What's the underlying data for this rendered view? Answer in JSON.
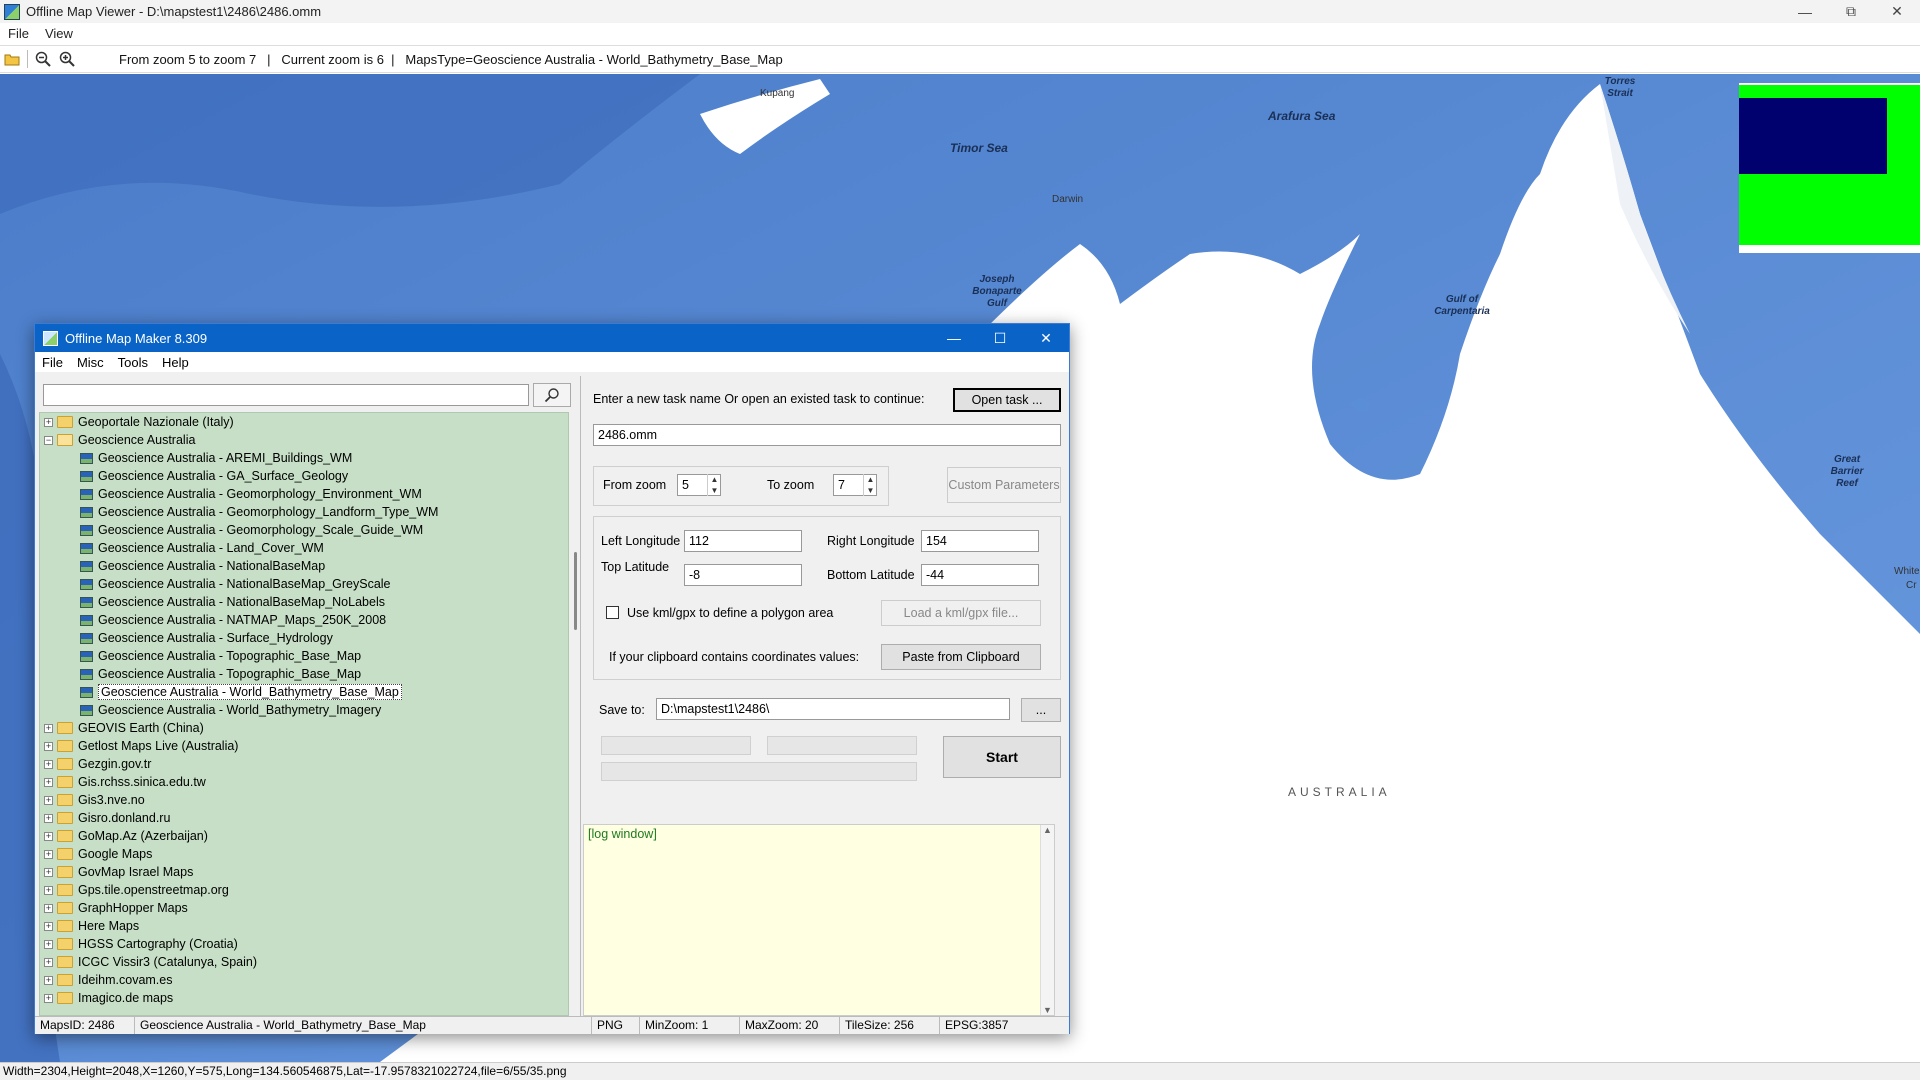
{
  "viewer": {
    "title": "Offline Map Viewer - D:\\mapstest1\\2486\\2486.omm",
    "menu": [
      "File",
      "View"
    ],
    "toolbar": {
      "zoom_range": "From zoom 5 to zoom 7",
      "current_zoom": "Current zoom is 6",
      "maps_type": "MapsType=Geoscience Australia - World_Bathymetry_Base_Map"
    },
    "status": "Width=2304,Height=2048,X=1260,Y=575,Long=134.560546875,Lat=-17.9578321022724,file=6/55/35.png"
  },
  "map": {
    "labels": {
      "kupang": "Kupang",
      "timor_sea": "Timor Sea",
      "arafura_sea": "Arafura Sea",
      "darwin": "Darwin",
      "joseph_bonaparte": "Joseph Bonaparte Gulf",
      "gulf_carpentaria": "Gulf of Carpentaria",
      "great_barrier_reef": "Great Barrier Reef",
      "torres_strait": "Torres Strait",
      "australia": "AUSTRALIA",
      "white": "White",
      "cr": "Cr"
    },
    "colors": {
      "ocean": "#5a8fd8",
      "deep_ocean": "#3f6fbf",
      "land": "#ffffff",
      "legend_green": "#00ff00",
      "legend_navy": "#00006e"
    }
  },
  "dialog": {
    "title": "Offline Map Maker 8.309",
    "menu": [
      "File",
      "Misc",
      "Tools",
      "Help"
    ],
    "search": {
      "value": "",
      "placeholder": ""
    },
    "tree": [
      {
        "label": "Geoportale Nazionale (Italy)",
        "level": 0,
        "expanded": false
      },
      {
        "label": "Geoscience Australia",
        "level": 0,
        "expanded": true
      },
      {
        "label": "Geoscience Australia - AREMI_Buildings_WM",
        "level": 1
      },
      {
        "label": "Geoscience Australia - GA_Surface_Geology",
        "level": 1
      },
      {
        "label": "Geoscience Australia - Geomorphology_Environment_WM",
        "level": 1
      },
      {
        "label": "Geoscience Australia - Geomorphology_Landform_Type_WM",
        "level": 1
      },
      {
        "label": "Geoscience Australia - Geomorphology_Scale_Guide_WM",
        "level": 1
      },
      {
        "label": "Geoscience Australia - Land_Cover_WM",
        "level": 1
      },
      {
        "label": "Geoscience Australia - NationalBaseMap",
        "level": 1
      },
      {
        "label": "Geoscience Australia - NationalBaseMap_GreyScale",
        "level": 1
      },
      {
        "label": "Geoscience Australia - NationalBaseMap_NoLabels",
        "level": 1
      },
      {
        "label": "Geoscience Australia - NATMAP_Maps_250K_2008",
        "level": 1
      },
      {
        "label": "Geoscience Australia - Surface_Hydrology",
        "level": 1
      },
      {
        "label": "Geoscience Australia - Topographic_Base_Map",
        "level": 1
      },
      {
        "label": "Geoscience Australia - Topographic_Base_Map",
        "level": 1
      },
      {
        "label": "Geoscience Australia - World_Bathymetry_Base_Map",
        "level": 1,
        "selected": true
      },
      {
        "label": "Geoscience Australia - World_Bathymetry_Imagery",
        "level": 1
      },
      {
        "label": "GEOVIS Earth (China)",
        "level": 0,
        "expanded": false
      },
      {
        "label": "Getlost Maps Live (Australia)",
        "level": 0,
        "expanded": false
      },
      {
        "label": "Gezgin.gov.tr",
        "level": 0,
        "expanded": false
      },
      {
        "label": "Gis.rchss.sinica.edu.tw",
        "level": 0,
        "expanded": false
      },
      {
        "label": "Gis3.nve.no",
        "level": 0,
        "expanded": false
      },
      {
        "label": "Gisro.donland.ru",
        "level": 0,
        "expanded": false
      },
      {
        "label": "GoMap.Az (Azerbaijan)",
        "level": 0,
        "expanded": false
      },
      {
        "label": "Google Maps",
        "level": 0,
        "expanded": false
      },
      {
        "label": "GovMap Israel Maps",
        "level": 0,
        "expanded": false
      },
      {
        "label": "Gps.tile.openstreetmap.org",
        "level": 0,
        "expanded": false
      },
      {
        "label": "GraphHopper Maps",
        "level": 0,
        "expanded": false
      },
      {
        "label": "Here Maps",
        "level": 0,
        "expanded": false
      },
      {
        "label": "HGSS Cartography (Croatia)",
        "level": 0,
        "expanded": false
      },
      {
        "label": "ICGC Vissir3 (Catalunya, Spain)",
        "level": 0,
        "expanded": false
      },
      {
        "label": "Ideihm.covam.es",
        "level": 0,
        "expanded": false
      },
      {
        "label": "Imagico.de maps",
        "level": 0,
        "expanded": false
      }
    ],
    "form": {
      "task_prompt": "Enter a new task name Or open an existed task to continue:",
      "open_task_label": "Open task ...",
      "task_name": "2486.omm",
      "from_zoom_label": "From zoom",
      "from_zoom": "5",
      "to_zoom_label": "To zoom",
      "to_zoom": "7",
      "custom_params_label": "Custom Parameters",
      "left_lon_label": "Left Longitude",
      "left_lon": "112",
      "right_lon_label": "Right Longitude",
      "right_lon": "154",
      "top_lat_label": "Top Latitude",
      "top_lat": "-8",
      "bottom_lat_label": "Bottom Latitude",
      "bottom_lat": "-44",
      "kml_label": "Use kml/gpx to define a polygon area",
      "kml_checked": false,
      "load_kml_label": "Load a kml/gpx file...",
      "clipboard_prompt": "If your clipboard contains coordinates values:",
      "paste_label": "Paste from Clipboard",
      "save_to_label": "Save to:",
      "save_to": "D:\\mapstest1\\2486\\",
      "browse_label": "...",
      "start_label": "Start"
    },
    "log": "[log window]",
    "status": {
      "maps_id": "MapsID: 2486",
      "maps_name": "Geoscience Australia - World_Bathymetry_Base_Map",
      "format": "PNG",
      "min_zoom": "MinZoom: 1",
      "max_zoom": "MaxZoom: 20",
      "tile_size": "TileSize: 256",
      "epsg": "EPSG:3857"
    }
  }
}
